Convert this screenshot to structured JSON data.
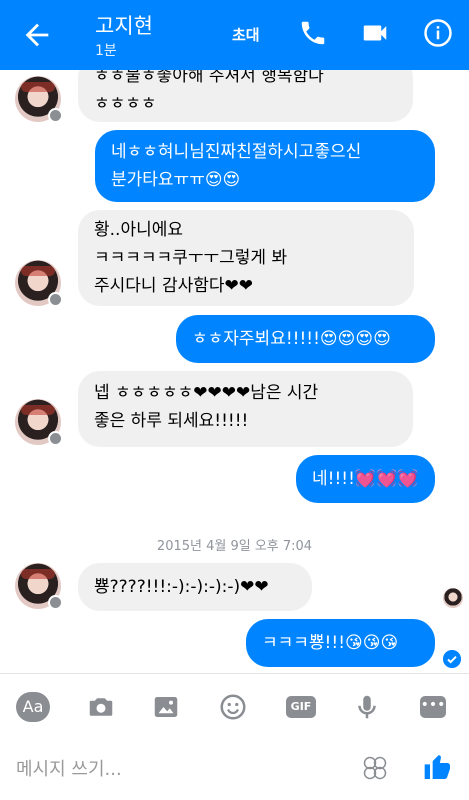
{
  "header": {
    "title": "고지현",
    "subtitle": "1분",
    "invite_label": "초대"
  },
  "messages": [
    {
      "side": "in",
      "text": "ㅎㅎ불ㅎ좋아해 주셔서 행복함다\nㅎㅎㅎㅎ"
    },
    {
      "side": "out",
      "text": "네ㅎㅎ혀니님진짜친절하시고좋으신\n분가타요ㅠㅠ😍😍"
    },
    {
      "side": "in",
      "text": "황..아니에요\nㅋㅋㅋㅋㅋ쿠ㅜㅜ그렇게 봐\n주시다니 감사함다❤❤"
    },
    {
      "side": "out",
      "text": "ㅎㅎ자주뵈요!!!!!😍😍😍😍"
    },
    {
      "side": "in",
      "text": "넵 ㅎㅎㅎㅎㅎ❤❤❤❤남은 시간\n좋은 하루 되세요!!!!!"
    },
    {
      "side": "out",
      "text": "네!!!!💓💓💓"
    },
    {
      "side": "in",
      "text": "뿅????!!!:-):-):-):-)❤❤"
    },
    {
      "side": "out",
      "text": "ㅋㅋㅋ뿅!!!😘😘😘"
    }
  ],
  "timestamp": "2015년 4월 9일 오후 7:04",
  "toolbar": {
    "aa_label": "Aa",
    "gif_label": "GIF",
    "more_label": "•••"
  },
  "composer": {
    "placeholder": "메시지 쓰기..."
  },
  "colors": {
    "accent": "#0084ff",
    "incoming_bubble": "#f1f0f0",
    "icon_gray": "#8a8d91"
  }
}
